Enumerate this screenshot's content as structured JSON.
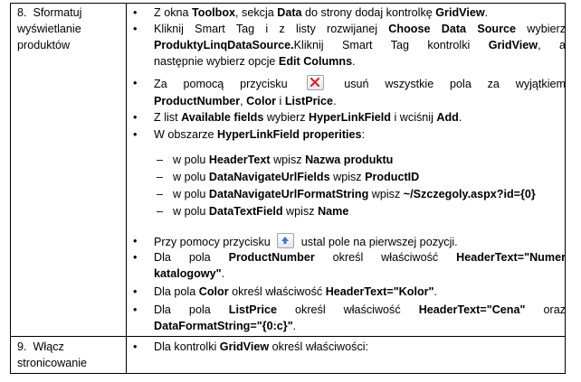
{
  "step8": {
    "number": "8.",
    "label_line1": "Sformatuj",
    "label_line2": "wyświetlanie",
    "label_line3": "produktów",
    "b1": [
      "Z okna ",
      "Toolbox",
      ", sekcja ",
      "Data",
      " do strony dodaj kontrolkę ",
      "GridView",
      "."
    ],
    "b2_line1": [
      "Kliknij Smart Tag i z listy rozwijanej ",
      "Choose Data Source",
      " wybierz"
    ],
    "b2_line2": [
      "ProduktyLinqDataSource.",
      "Kliknij Smart Tag kontrolki ",
      "GridView",
      ", a"
    ],
    "b2_line3": [
      "następnie wybierz opcje ",
      "Edit Columns",
      "."
    ],
    "b3_line1": [
      "Za pomocą przycisku",
      "usuń wszystkie pola za wyjątkiem"
    ],
    "b3_line2": [
      "ProductNumber",
      ", ",
      "Color",
      " i ",
      "ListPrice",
      "."
    ],
    "b4": [
      "Z list ",
      "Available fields",
      " wybierz ",
      "HyperLinkField",
      " i wciśnij ",
      "Add",
      "."
    ],
    "b5": [
      "W obszarze ",
      "HyperLinkField properities",
      ":"
    ],
    "d1": [
      "w polu ",
      "HeaderText",
      " wpisz ",
      "Nazwa produktu"
    ],
    "d2": [
      "w polu ",
      "DataNavigateUrlFields",
      " wpisz ",
      "ProductID"
    ],
    "d3": [
      "w polu ",
      "DataNavigateUrlFormatString",
      " wpisz ",
      "~/Szczegoly.aspx?id={0}"
    ],
    "d4": [
      "w polu ",
      "DataTextField",
      " wpisz ",
      "Name"
    ],
    "b6": [
      "Przy pomocy przycisku",
      "ustal pole na pierwszej pozycji."
    ],
    "b7_line1": [
      "Dla pola ",
      "ProductNumber",
      " określ właściwość ",
      "HeaderText=\"Numer"
    ],
    "b7_line2": [
      "katalogowy\"",
      "."
    ],
    "b8": [
      "Dla pola ",
      "Color",
      " określ właściwość ",
      "HeaderText=\"Kolor\"",
      "."
    ],
    "b9_line1": [
      "Dla pola ",
      "ListPrice",
      " określ właściwość ",
      "HeaderText=\"Cena\"",
      " oraz"
    ],
    "b9_line2": [
      "DataFormatString=\"{0:c}\"",
      "."
    ]
  },
  "step9": {
    "number": "9.",
    "label_line1": "Włącz",
    "label_line2": "stronicowanie",
    "b1": [
      "Dla kontrolki ",
      "GridView",
      " określ właściwości:"
    ]
  },
  "icons": {
    "delete": "delete-x-icon",
    "move_up": "move-up-arrow-icon"
  },
  "colors": {
    "delete_icon": "#d9262a",
    "move_up_icon": "#3a74c9"
  }
}
